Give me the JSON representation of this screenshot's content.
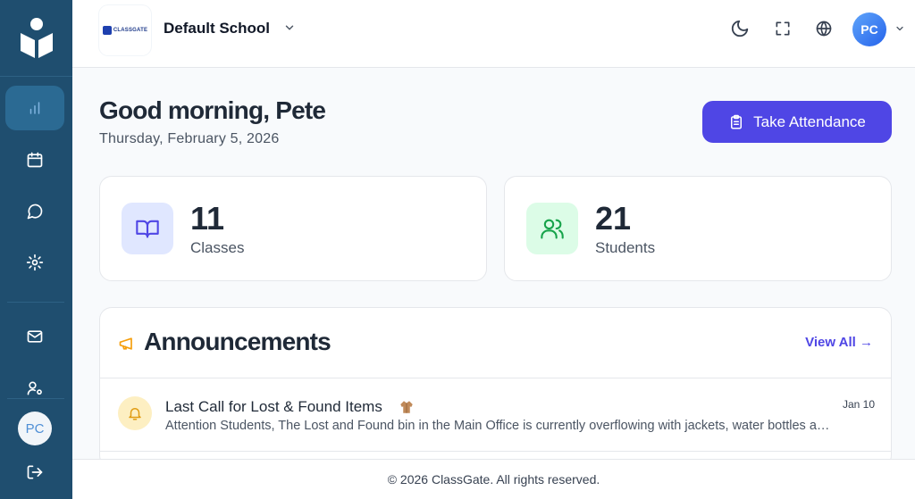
{
  "sidebar": {
    "items": [
      {
        "icon": "bar-chart-icon",
        "active": true
      },
      {
        "icon": "calendar-icon"
      },
      {
        "icon": "message-icon"
      },
      {
        "icon": "gear-icon"
      },
      {
        "icon": "mail-icon"
      },
      {
        "icon": "user-settings-icon"
      }
    ],
    "avatar_initials": "PC",
    "logout_icon": "logout-icon"
  },
  "header": {
    "school_logo_text": "CLASSGATE",
    "school_name": "Default School",
    "avatar_initials": "PC"
  },
  "main": {
    "greeting": "Good morning, Pete",
    "date": "Thursday, February 5, 2026",
    "attendance_button": "Take Attendance",
    "stats": [
      {
        "value": "11",
        "label": "Classes"
      },
      {
        "value": "21",
        "label": "Students"
      }
    ]
  },
  "announcements": {
    "title": "Announcements",
    "view_all": "View All →",
    "items": [
      {
        "title": "Last Call for Lost & Found Items",
        "description": "Attention Students, The Lost and Found bin in the Main Office is currently overflowing with jackets, water bottles and more",
        "date": "Jan 10"
      }
    ]
  },
  "footer": {
    "text": "© 2026 ClassGate. All rights reserved."
  },
  "colors": {
    "sidebar": "#1f4e6f",
    "accent": "#4f46e5",
    "classes_icon_bg": "#e0e7ff",
    "students_icon_bg": "#dcfce7"
  }
}
